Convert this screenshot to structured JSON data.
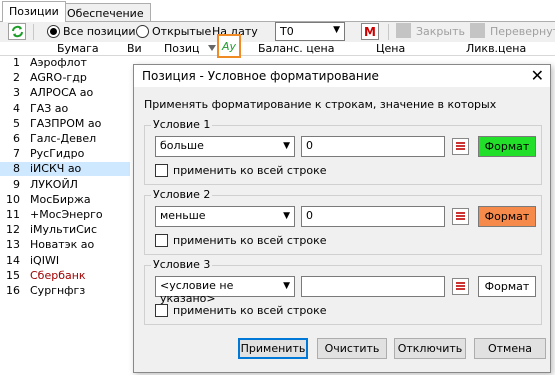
{
  "tabs": [
    "Позиции",
    "Обеспечение"
  ],
  "toolbar": {
    "radio_all": "Все позиции",
    "radio_open": "Открытые",
    "date_label": "На дату",
    "date_value": "T0",
    "close_label": "Закрыть",
    "flip_label": "Перевернуть"
  },
  "columns": [
    "Бумага",
    "Ви",
    "Позиц",
    "Баланс. цена",
    "Цена",
    "Ликв.цена"
  ],
  "rows": [
    {
      "n": "1",
      "name": "Аэрофлот"
    },
    {
      "n": "2",
      "name": "AGRO-гдр"
    },
    {
      "n": "3",
      "name": "АЛРОСА ао"
    },
    {
      "n": "4",
      "name": "ГАЗ ао"
    },
    {
      "n": "5",
      "name": "ГАЗПРОМ ао"
    },
    {
      "n": "6",
      "name": "Галс-Девел"
    },
    {
      "n": "7",
      "name": "РусГидро"
    },
    {
      "n": "8",
      "name": "iИСКЧ ао"
    },
    {
      "n": "9",
      "name": "ЛУКОЙЛ"
    },
    {
      "n": "10",
      "name": "МосБиржа"
    },
    {
      "n": "11",
      "name": "+МосЭнерго"
    },
    {
      "n": "12",
      "name": "iМультиСис"
    },
    {
      "n": "13",
      "name": "Новатэк ао"
    },
    {
      "n": "14",
      "name": "iQIWI"
    },
    {
      "n": "15",
      "name": "Сбербанк"
    },
    {
      "n": "16",
      "name": "Сургнфгз"
    }
  ],
  "selected_row": 8,
  "red_row": 15,
  "dialog": {
    "title": "Позиция - Условное форматирование",
    "intro": "Применять форматирование к строкам, значение в которых",
    "conditions": [
      {
        "label": "Условие 1",
        "op": "больше",
        "value": "0",
        "apply_row": "применить ко всей строке",
        "format": "Формат",
        "format_color": "#22e02a"
      },
      {
        "label": "Условие 2",
        "op": "меньше",
        "value": "0",
        "apply_row": "применить ко всей строке",
        "format": "Формат",
        "format_color": "#f58a4b"
      },
      {
        "label": "Условие 3",
        "op": "<условие не указано>",
        "value": "",
        "apply_row": "применить ко всей строке",
        "format": "Формат",
        "format_color": "#ffffff"
      }
    ],
    "buttons": {
      "apply": "Применить",
      "clear": "Очистить",
      "disable": "Отключить",
      "cancel": "Отмена"
    }
  },
  "colors": {
    "accent": "#0078d7",
    "highlight_box": "#f08a24",
    "selected_row": "#cde8ff"
  }
}
